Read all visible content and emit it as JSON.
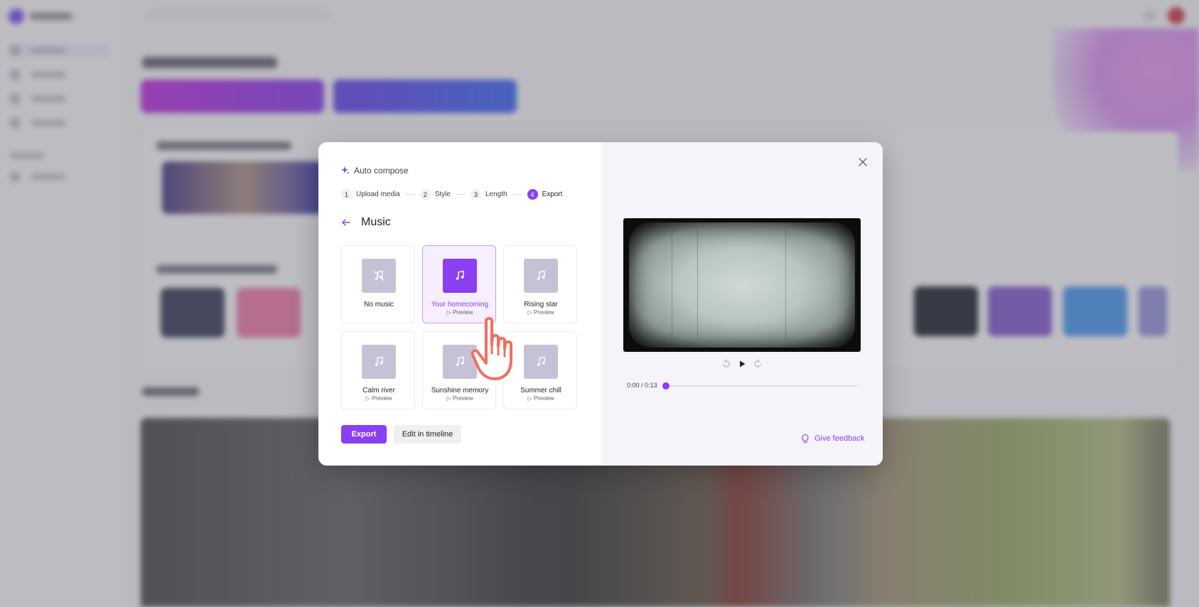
{
  "dialog": {
    "header": {
      "icon": "sparkle-icon",
      "title": "Auto compose"
    },
    "steps": [
      {
        "number": "1",
        "label": "Upload media"
      },
      {
        "number": "2",
        "label": "Style"
      },
      {
        "number": "3",
        "label": "Length"
      },
      {
        "number": "4",
        "label": "Export",
        "current": true
      }
    ],
    "section_title": "Music",
    "music_options": [
      {
        "name": "No music",
        "preview": "",
        "selected": false,
        "icon": "no-music-icon"
      },
      {
        "name": "Your homecoming",
        "preview": "▷ Preview",
        "selected": true,
        "icon": "music-note-icon"
      },
      {
        "name": "Rising star",
        "preview": "▷ Preview",
        "selected": false,
        "icon": "music-note-icon"
      },
      {
        "name": "Calm river",
        "preview": "▷ Preview",
        "selected": false,
        "icon": "music-note-icon"
      },
      {
        "name": "Sunshine memory",
        "preview": "▷ Preview",
        "selected": false,
        "icon": "music-note-icon"
      },
      {
        "name": "Summer chill",
        "preview": "▷ Preview",
        "selected": false,
        "icon": "music-note-icon"
      }
    ],
    "buttons": {
      "export": "Export",
      "edit_timeline": "Edit in timeline"
    },
    "player": {
      "time": "0:00 / 0:13",
      "progress": 0.0
    },
    "feedback": "Give feedback"
  },
  "colors": {
    "accent": "#8a3ff0",
    "selected_bg": "#f6efff",
    "tile_art": "#c5c2d6",
    "cursor": "#f0705e"
  }
}
